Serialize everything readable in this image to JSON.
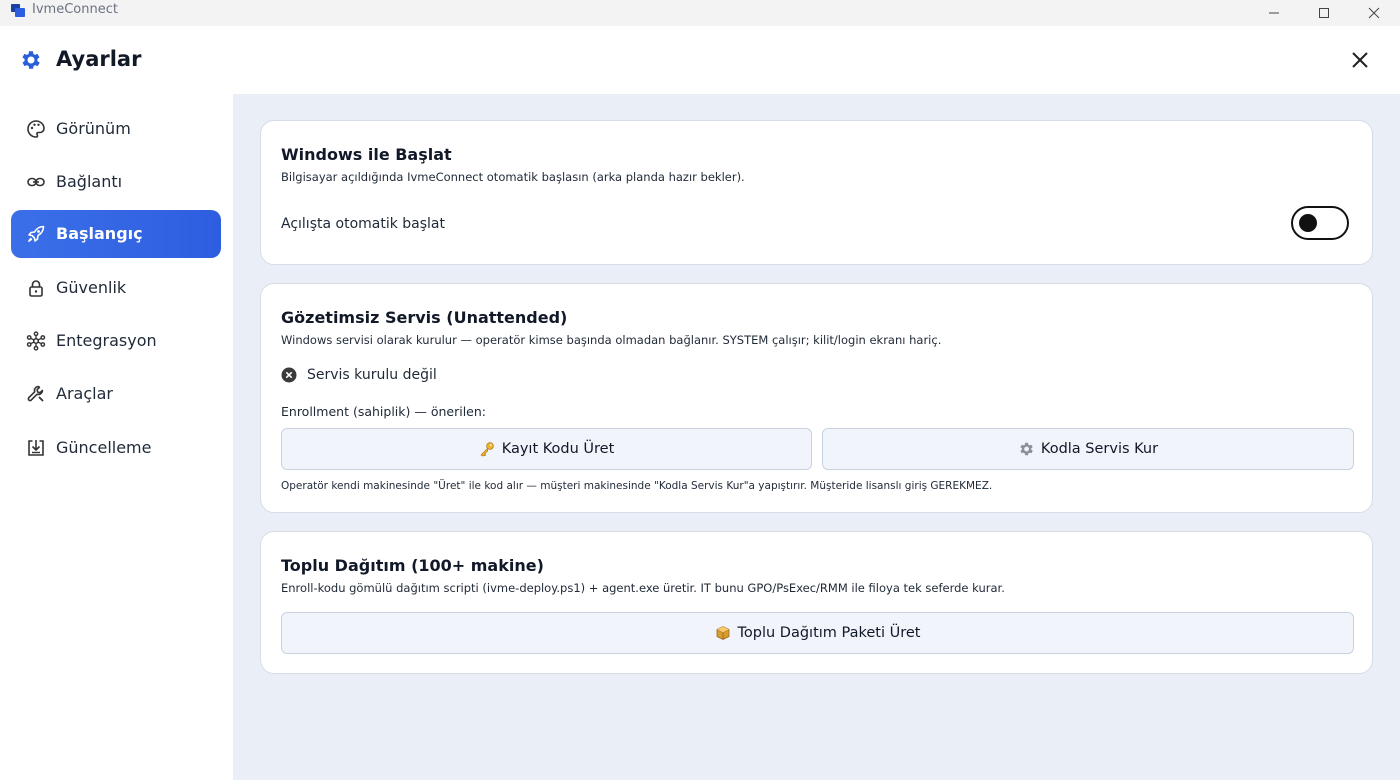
{
  "window": {
    "app_title": "IvmeConnect"
  },
  "header": {
    "title": "Ayarlar"
  },
  "sidebar": {
    "items": [
      {
        "label": "Görünüm",
        "icon": "palette-icon",
        "active": false
      },
      {
        "label": "Bağlantı",
        "icon": "link-icon",
        "active": false
      },
      {
        "label": "Başlangıç",
        "icon": "rocket-icon",
        "active": true
      },
      {
        "label": "Güvenlik",
        "icon": "lock-icon",
        "active": false
      },
      {
        "label": "Entegrasyon",
        "icon": "hub-icon",
        "active": false
      },
      {
        "label": "Araçlar",
        "icon": "wrench-icon",
        "active": false
      },
      {
        "label": "Güncelleme",
        "icon": "download-icon",
        "active": false
      }
    ]
  },
  "startup_card": {
    "title": "Windows ile Başlat",
    "subtitle": "Bilgisayar açıldığında IvmeConnect otomatik başlasın (arka planda hazır bekler).",
    "toggle_label": "Açılışta otomatik başlat",
    "toggle_on": false
  },
  "service_card": {
    "title": "Gözetimsiz Servis (Unattended)",
    "subtitle": "Windows servisi olarak kurulur — operatör kimse başında olmadan bağlanır. SYSTEM çalışır; kilit/login ekranı hariç.",
    "status_text": "Servis kurulu değil",
    "enrollment_label": "Enrollment (sahiplik) — önerilen:",
    "generate_code_button": "Kayıt Kodu Üret",
    "install_with_code_button": "Kodla Servis Kur",
    "note": "Operatör kendi makinesinde \"Üret\" ile kod alır — müşteri makinesinde \"Kodla Servis Kur\"a yapıştırır. Müşteride lisanslı giriş GEREKMEZ."
  },
  "deploy_card": {
    "title": "Toplu Dağıtım (100+ makine)",
    "subtitle": "Enroll-kodu gömülü dağıtım scripti (ivme-deploy.ps1) + agent.exe üretir. IT bunu GPO/PsExec/RMM ile filoya tek seferde kurar.",
    "generate_package_button": "Toplu Dağıtım Paketi Üret"
  },
  "colors": {
    "accent": "#2e5ee0",
    "main_bg": "#eaeff7",
    "card_border": "#d5dce8",
    "gear": "#2b5fd9"
  }
}
